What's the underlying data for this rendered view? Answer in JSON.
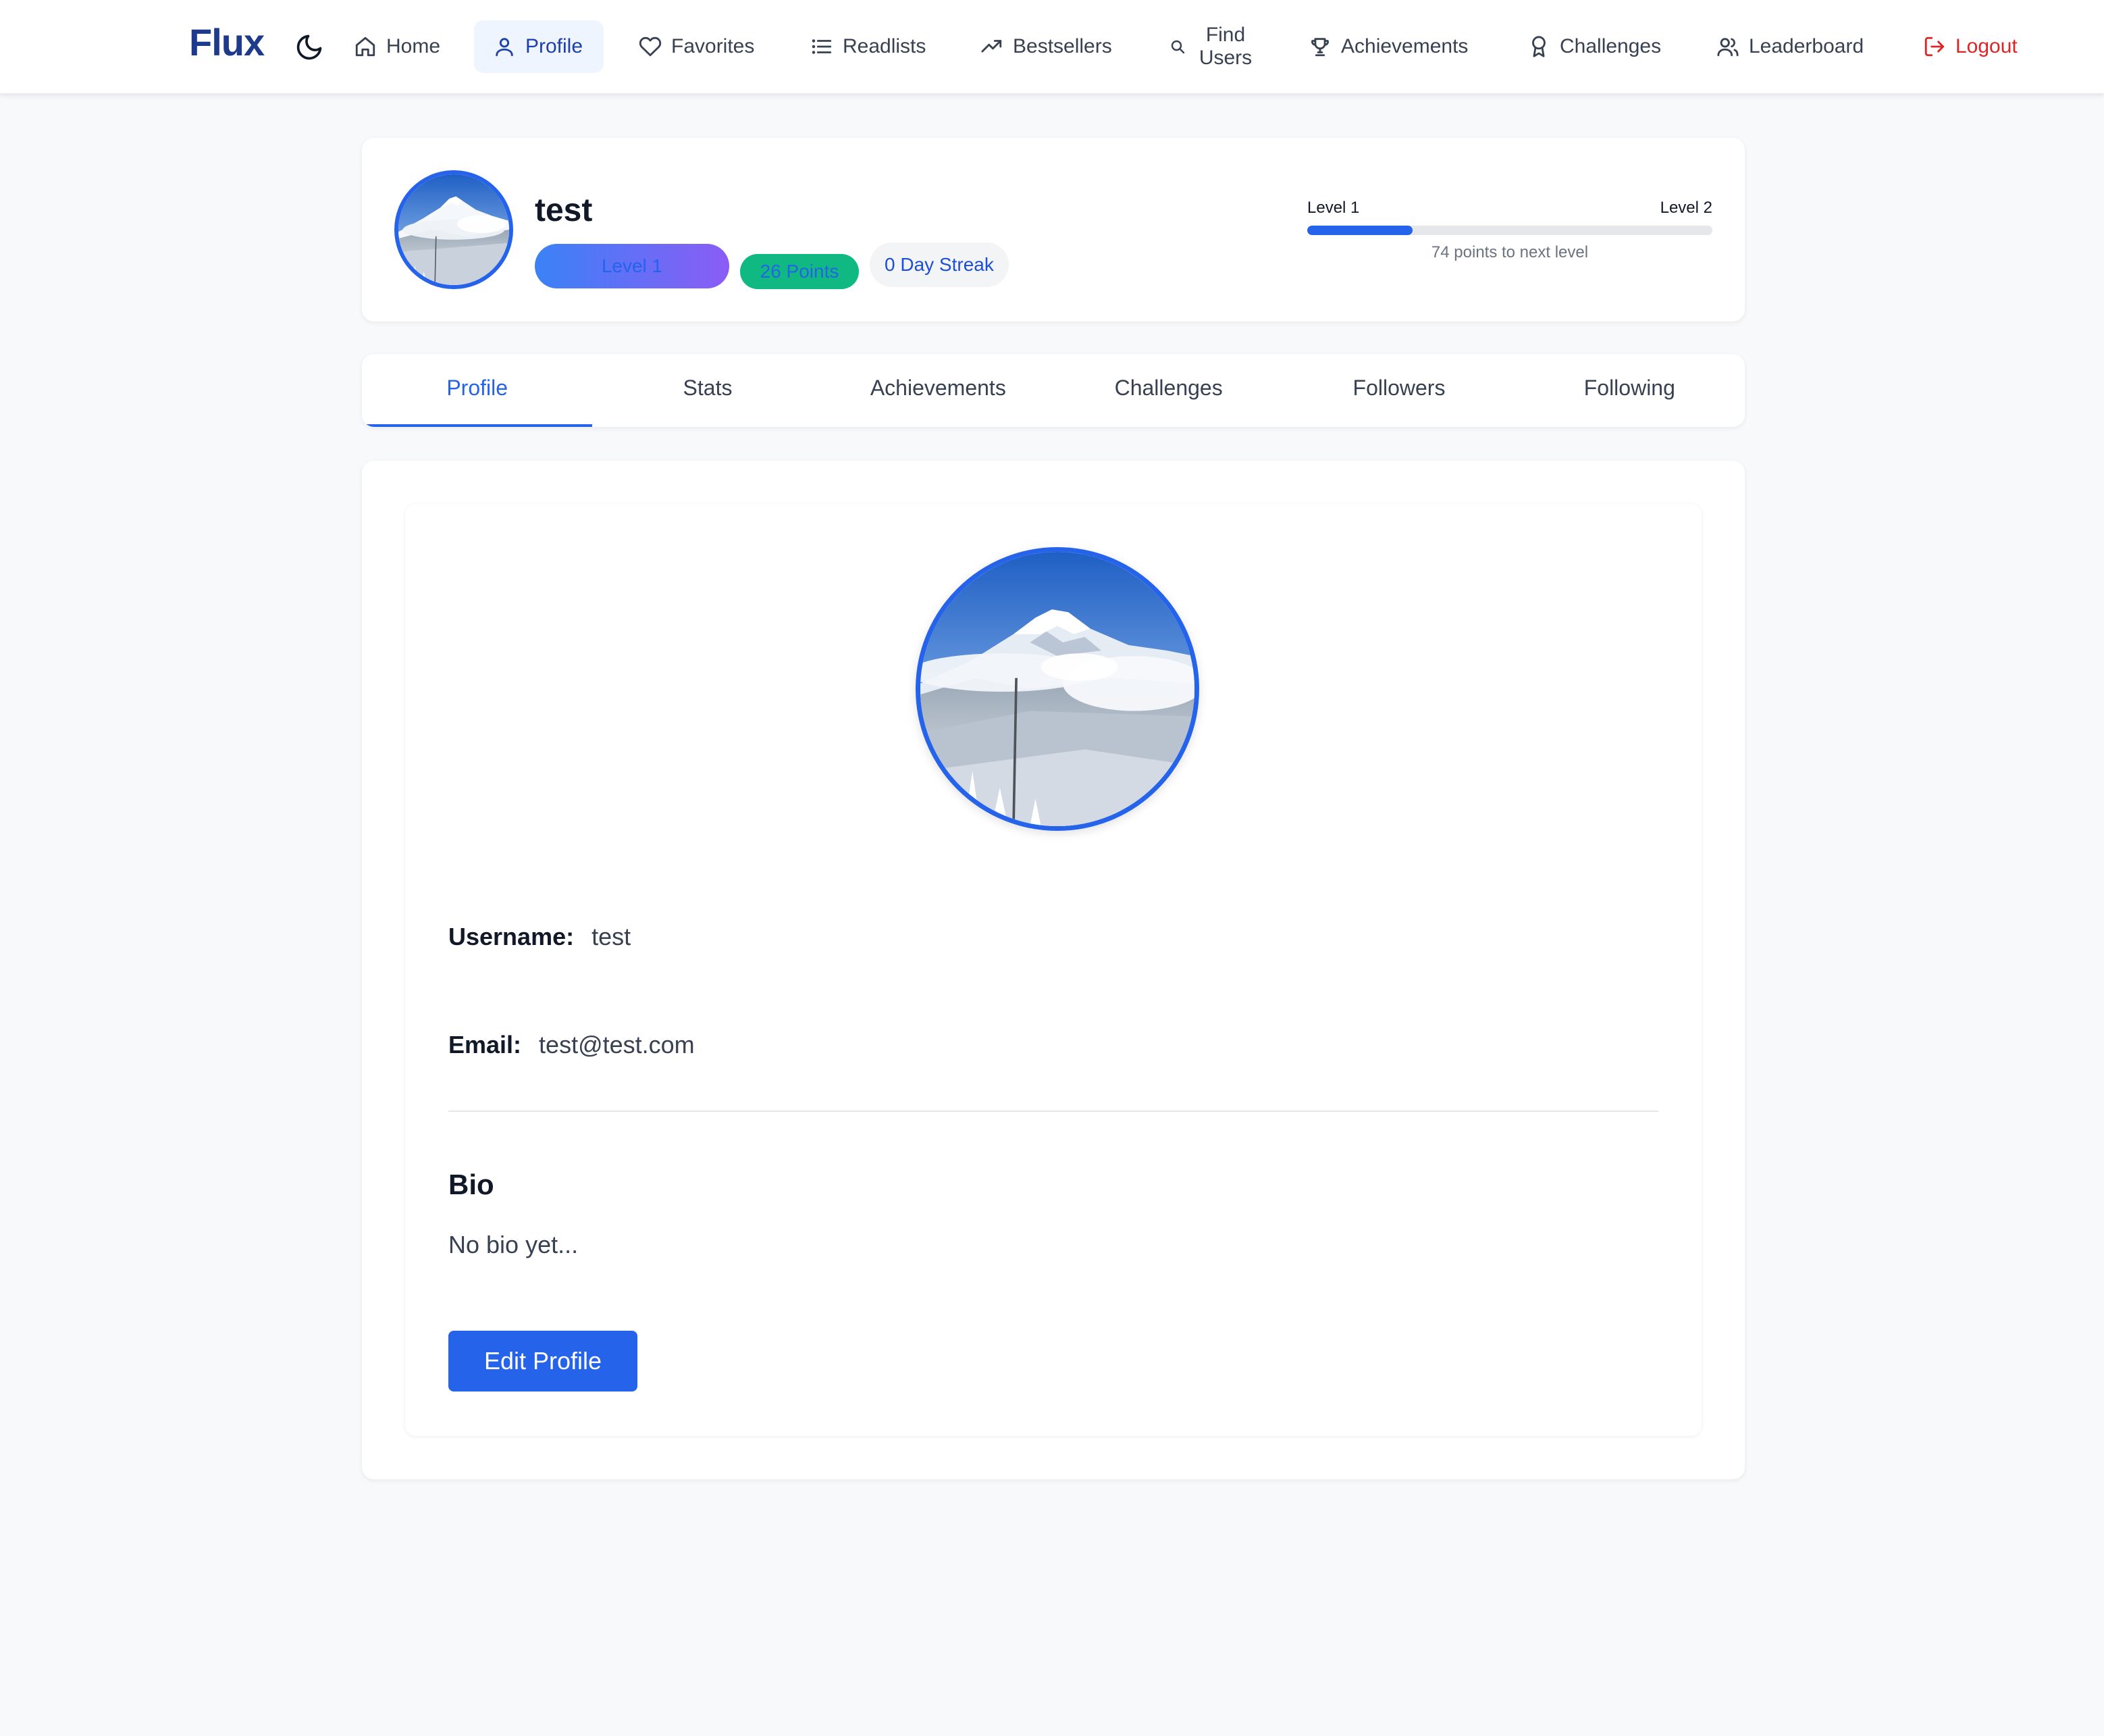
{
  "brand": "Flux",
  "nav": {
    "theme_toggle_icon": "moon-icon",
    "items": [
      {
        "label": "Home",
        "icon": "home-icon"
      },
      {
        "label": "Profile",
        "icon": "user-icon"
      },
      {
        "label": "Favorites",
        "icon": "heart-icon"
      },
      {
        "label": "Readlists",
        "icon": "list-icon"
      },
      {
        "label": "Bestsellers",
        "icon": "trending-up-icon"
      },
      {
        "label_line1": "Find",
        "label_line2": "Users",
        "icon": "search-icon"
      },
      {
        "label": "Achievements",
        "icon": "trophy-icon"
      },
      {
        "label": "Challenges",
        "icon": "award-icon"
      },
      {
        "label": "Leaderboard",
        "icon": "users-icon"
      },
      {
        "label": "Logout",
        "icon": "logout-icon"
      }
    ]
  },
  "profile_header": {
    "name": "test",
    "level_badge": "Level 1",
    "points_badge": "26 Points",
    "streak_badge": "0 Day Streak",
    "progress": {
      "current_level": "Level 1",
      "next_level": "Level 2",
      "fraction": 0.26,
      "caption": "74 points to next level"
    }
  },
  "tabs": [
    "Profile",
    "Stats",
    "Achievements",
    "Challenges",
    "Followers",
    "Following"
  ],
  "profile_details": {
    "username_label": "Username:",
    "username_value": "test",
    "email_label": "Email:",
    "email_value": "test@test.com",
    "bio_heading": "Bio",
    "bio_text": "No bio yet...",
    "edit_button": "Edit Profile"
  },
  "colors": {
    "accent": "#2563eb",
    "brand": "#1e3a8a",
    "logout": "#dc2626",
    "points_badge": "#10b981"
  }
}
